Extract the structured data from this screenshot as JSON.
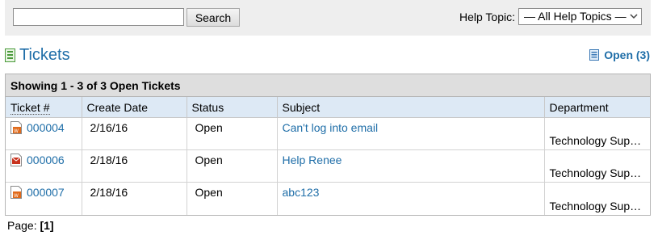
{
  "search": {
    "value": "",
    "button_label": "Search"
  },
  "help_topic": {
    "label": "Help Topic:",
    "selected": "— All Help Topics —"
  },
  "page_title": "Tickets",
  "open_link": "Open (3)",
  "table": {
    "caption": "Showing 1 - 3 of 3 Open Tickets",
    "headers": [
      "Ticket #",
      "Create Date",
      "Status",
      "Subject",
      "Department"
    ],
    "rows": [
      {
        "ticket": "000004",
        "date": "2/16/16",
        "status": "Open",
        "subject": "Can't log into email",
        "department": "Technology Sup…",
        "icon": "web-ticket-icon"
      },
      {
        "ticket": "000006",
        "date": "2/18/16",
        "status": "Open",
        "subject": "Help Renee",
        "department": "Technology Sup…",
        "icon": "email-ticket-icon"
      },
      {
        "ticket": "000007",
        "date": "2/18/16",
        "status": "Open",
        "subject": "abc123",
        "department": "Technology Sup…",
        "icon": "web-ticket-icon"
      }
    ]
  },
  "pager": {
    "label": "Page:",
    "current": "[1]"
  },
  "colors": {
    "link": "#1f6ea8",
    "header_bg": "#dde9f5",
    "caption_bg": "#dedede",
    "topbar_bg": "#eeeeee"
  }
}
